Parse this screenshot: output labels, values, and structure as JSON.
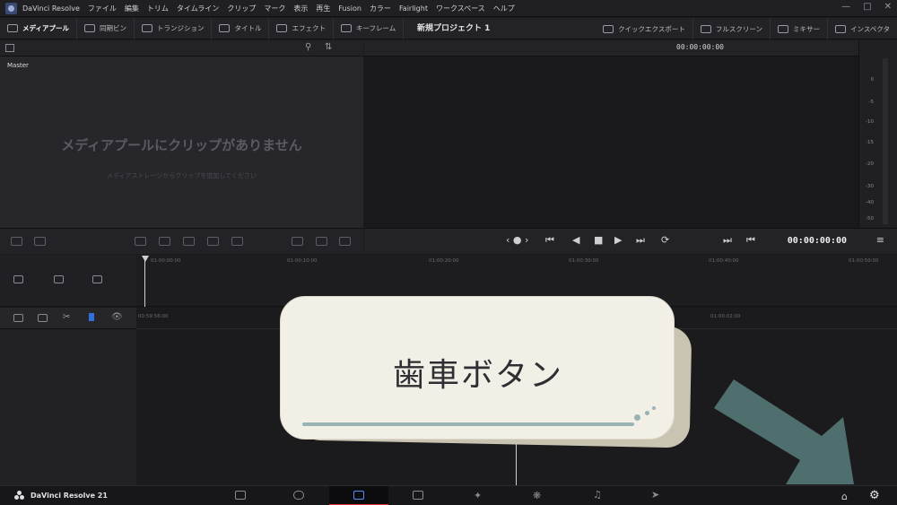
{
  "app": {
    "title": "DaVinci Resolve",
    "menu": [
      "ファイル",
      "編集",
      "トリム",
      "タイムライン",
      "クリップ",
      "マーク",
      "表示",
      "再生",
      "Fusion",
      "カラー",
      "Fairlight",
      "ワークスペース",
      "ヘルプ"
    ]
  },
  "toolbar": {
    "media_pool": "メディアプール",
    "sync_bin": "同期ビン",
    "transitions": "トランジション",
    "titles": "タイトル",
    "effects": "エフェクト",
    "keyframes": "キーフレーム",
    "project_title": "新規プロジェクト 1",
    "quick_export": "クイックエクスポート",
    "fullscreen": "フルスクリーン",
    "mixer": "ミキサー",
    "inspector": "インスペクタ"
  },
  "media_pool": {
    "bin": "Master",
    "empty_title": "メディアプールにクリップがありません",
    "empty_sub": "メディアストレージからクリップを追加してください"
  },
  "viewer": {
    "timecode_top": "00:00:00:00",
    "timecode_main": "00:00:00:00"
  },
  "meter": {
    "labels": [
      "0",
      "-5",
      "-10",
      "-15",
      "-20",
      "-30",
      "-40",
      "-50"
    ]
  },
  "timeline": {
    "ruler_top": [
      "01:00:00:00",
      "01:00:10:00",
      "01:00:20:00",
      "01:00:30:00",
      "01:00:40:00",
      "01:00:50:00"
    ],
    "ruler_bottom_left": "00:59:56:00",
    "ruler_bottom_right": "01:00:02:00"
  },
  "pagebar": {
    "brand": "DaVinci Resolve 21"
  },
  "annotation": {
    "label": "歯車ボタン"
  },
  "colors": {
    "accent_red": "#e0343b",
    "arrow": "#4f6e6e",
    "note_bg": "#f2efe6"
  }
}
